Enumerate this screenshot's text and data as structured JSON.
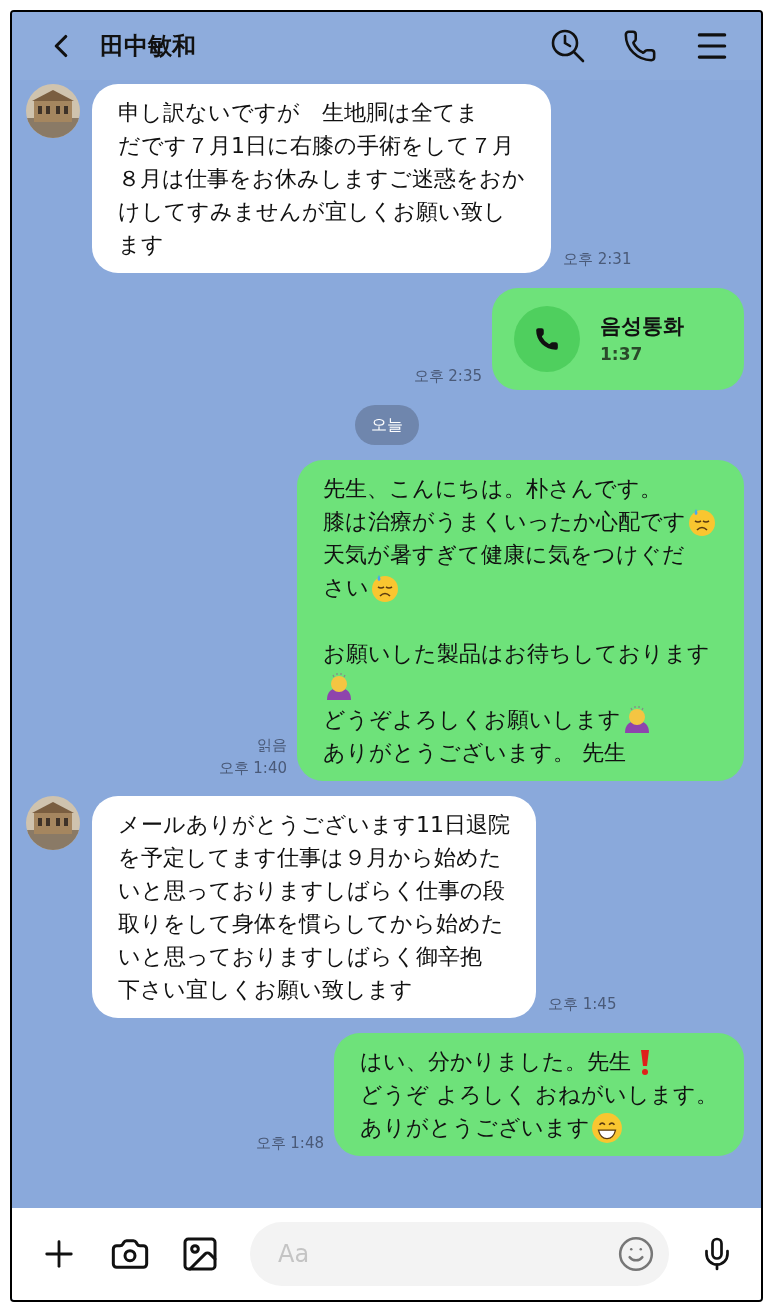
{
  "header": {
    "title": "田中敏和"
  },
  "messages": [
    {
      "kind": "incoming",
      "time": "오후 2:31",
      "lines": [
        [
          {
            "kind": "text",
            "text": "申し訳ないですが　生地胴は全てま"
          }
        ],
        [
          {
            "kind": "text",
            "text": "だです７月1日に右膝の手術をして７月"
          }
        ],
        [
          {
            "kind": "text",
            "text": "８月は仕事をお休みしますご迷惑をおか"
          }
        ],
        [
          {
            "kind": "text",
            "text": "けしてすみませんが宜しくお願い致し"
          }
        ],
        [
          {
            "kind": "text",
            "text": "ます"
          }
        ]
      ]
    },
    {
      "kind": "call",
      "label": "음성통화",
      "duration": "1:37",
      "time": "오후 2:35"
    },
    {
      "kind": "date",
      "text": "오늘"
    },
    {
      "kind": "outgoing",
      "time": "오후 1:40",
      "read": true,
      "read_label": "읽음",
      "lines": [
        [
          {
            "kind": "text",
            "text": "先生、こんにちは。朴さんです。"
          }
        ],
        [
          {
            "kind": "text",
            "text": "膝は治療がうまくいったか心配です"
          },
          {
            "kind": "sweat"
          }
        ],
        [
          {
            "kind": "text",
            "text": "天気が暑すぎて健康に気をつけぐだ"
          }
        ],
        [
          {
            "kind": "text",
            "text": "さい"
          },
          {
            "kind": "sweat"
          }
        ],
        [
          {
            "kind": "gap"
          }
        ],
        [
          {
            "kind": "text",
            "text": "お願いした製品はお待ちしております"
          }
        ],
        [
          {
            "kind": "bow"
          }
        ],
        [
          {
            "kind": "text",
            "text": "どうぞよろしくお願いします"
          },
          {
            "kind": "bow"
          }
        ],
        [
          {
            "kind": "text",
            "text": "ありがとうございます。 先生"
          }
        ]
      ]
    },
    {
      "kind": "incoming",
      "time": "오후 1:45",
      "lines": [
        [
          {
            "kind": "text",
            "text": "メールありがとうございます11日退院"
          }
        ],
        [
          {
            "kind": "text",
            "text": "を予定してます仕事は９月から始めた"
          }
        ],
        [
          {
            "kind": "text",
            "text": "いと思っておりますしばらく仕事の段"
          }
        ],
        [
          {
            "kind": "text",
            "text": "取りをして身体を慣らしてから始めた"
          }
        ],
        [
          {
            "kind": "text",
            "text": "いと思っておりますしばらく御辛抱"
          }
        ],
        [
          {
            "kind": "text",
            "text": "下さい宜しくお願い致します"
          }
        ]
      ]
    },
    {
      "kind": "outgoing",
      "time": "오후 1:48",
      "read": false,
      "lines": [
        [
          {
            "kind": "text",
            "text": "はい、分かりました。先生 "
          },
          {
            "kind": "exclaim"
          }
        ],
        [
          {
            "kind": "text",
            "text": "どうぞ よろしく おねがいします。"
          }
        ],
        [
          {
            "kind": "text",
            "text": "ありがとうございます"
          },
          {
            "kind": "grin"
          }
        ]
      ]
    }
  ],
  "composer": {
    "placeholder": "Aa"
  }
}
